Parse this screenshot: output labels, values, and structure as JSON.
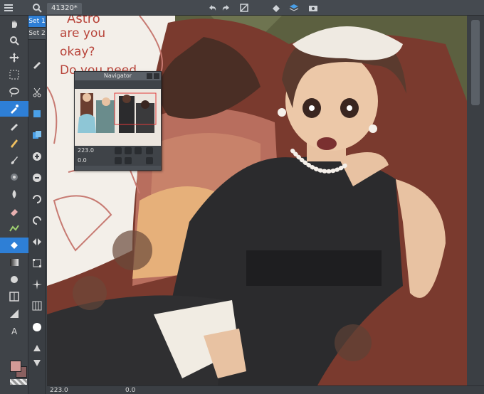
{
  "document": {
    "tab_label": "41320*"
  },
  "sets": {
    "set1": "Set 1",
    "set2": "Set 2"
  },
  "navigator": {
    "title": "Navigator",
    "zoom": "223.0",
    "rotation": "0.0"
  },
  "status": {
    "zoom": "223.0",
    "rotation": "0.0"
  },
  "canvas_text": {
    "line1": "Astro",
    "line2": "are you",
    "line3": "okay?",
    "line4": "Do you need"
  },
  "colors": {
    "main": "#d39a96",
    "sub": "#8a6060",
    "ui_bg": "#3b3f44",
    "accent": "#2e7fd6"
  },
  "icons": [
    "hand-icon",
    "zoom-icon",
    "move-icon",
    "select-icon",
    "lasso-icon",
    "eyedropper-icon",
    "pen-icon",
    "pencil-icon",
    "brush-icon",
    "airbrush-icon",
    "eraser-icon",
    "fill-icon",
    "gradient-icon",
    "shape-icon",
    "text-icon"
  ]
}
